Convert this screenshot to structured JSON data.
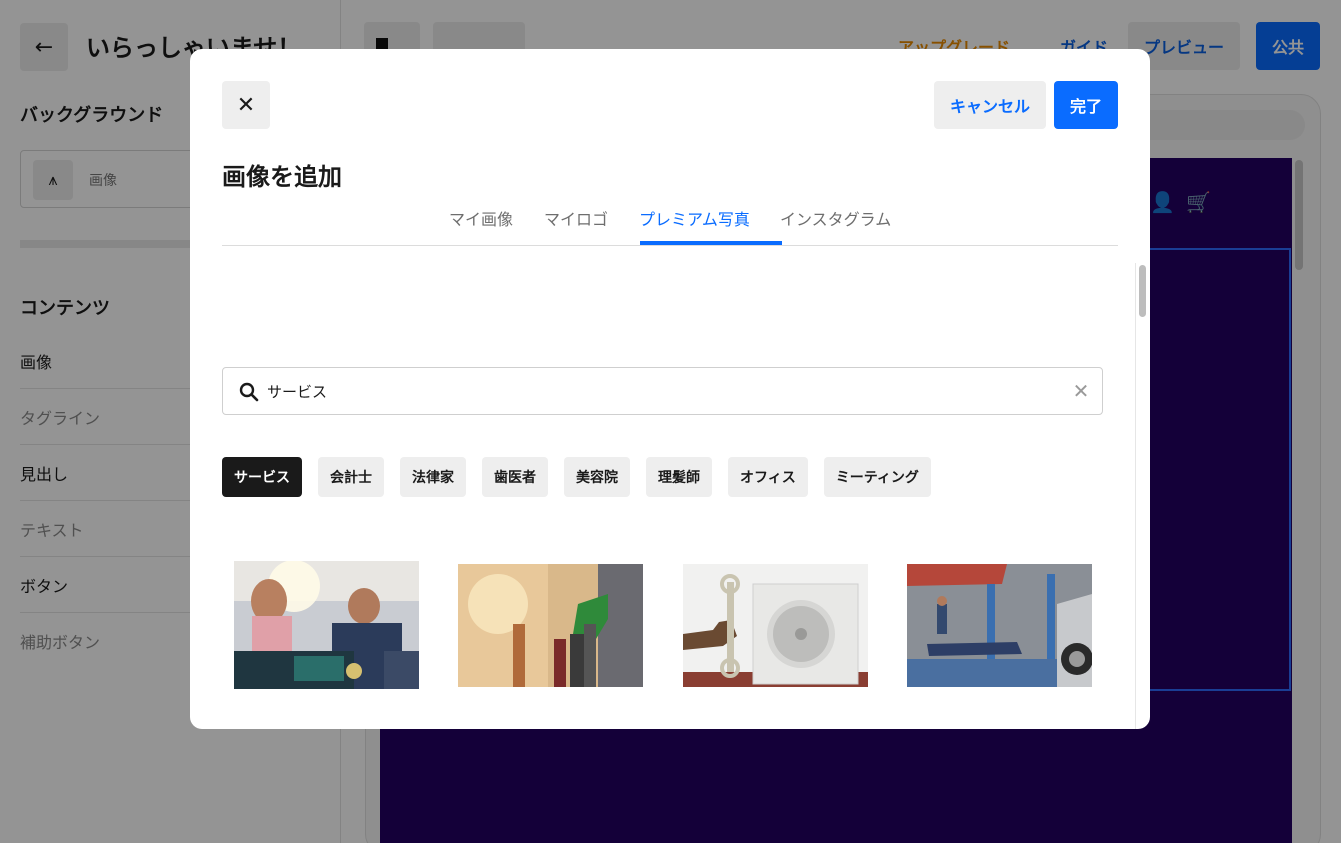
{
  "editor": {
    "page_title": "いらっしゃいませ！",
    "background_section": "バックグラウンド",
    "background_field_label": "画像",
    "content_section": "コンテンツ",
    "content_items": [
      {
        "label": "画像",
        "muted": false
      },
      {
        "label": "タグライン",
        "muted": true
      },
      {
        "label": "見出し",
        "muted": false
      },
      {
        "label": "テキスト",
        "muted": true
      },
      {
        "label": "ボタン",
        "muted": false
      },
      {
        "label": "補助ボタン",
        "muted": true
      }
    ],
    "upgrade_label": "アップグレード",
    "guide_label": "ガイド",
    "preview_label": "プレビュー",
    "publish_label": "公共"
  },
  "modal": {
    "title": "画像を追加",
    "cancel_label": "キャンセル",
    "done_label": "完了",
    "tabs": [
      {
        "label": "マイ画像",
        "active": false
      },
      {
        "label": "マイロゴ",
        "active": false
      },
      {
        "label": "プレミアム写真",
        "active": true
      },
      {
        "label": "インスタグラム",
        "active": false
      }
    ],
    "search": {
      "value": "サービス"
    },
    "chips": [
      {
        "label": "サービス",
        "selected": true
      },
      {
        "label": "会計士",
        "selected": false
      },
      {
        "label": "法律家",
        "selected": false
      },
      {
        "label": "歯医者",
        "selected": false
      },
      {
        "label": "美容院",
        "selected": false
      },
      {
        "label": "理髪師",
        "selected": false
      },
      {
        "label": "オフィス",
        "selected": false
      },
      {
        "label": "ミーティング",
        "selected": false
      }
    ],
    "images": [
      {
        "name": "mechanic-teaching-photo"
      },
      {
        "name": "fuel-pump-nozzle-photo"
      },
      {
        "name": "wrench-air-conditioner-photo"
      },
      {
        "name": "car-garage-lift-photo"
      }
    ]
  },
  "colors": {
    "accent": "#0a6cff",
    "upgrade": "#e88a00",
    "site_background": "#230063",
    "chip_selected": "#1a1a1a"
  }
}
